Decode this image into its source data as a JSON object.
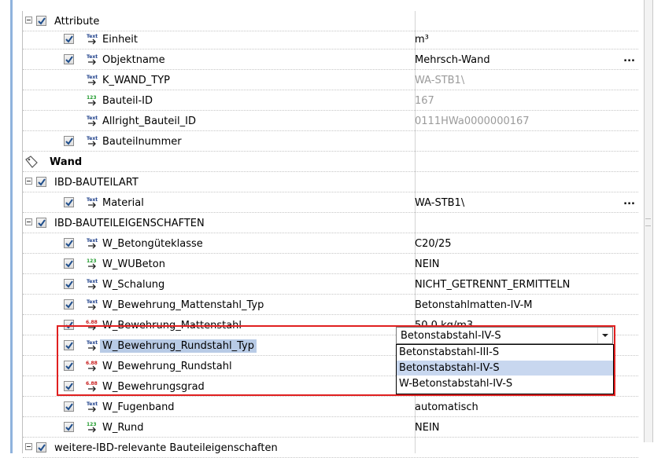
{
  "rows": [
    {
      "type": "section",
      "label": "Attribute"
    },
    {
      "type": "attr",
      "icon": "text",
      "label": "Einheit",
      "value": "m³",
      "checkbox": true
    },
    {
      "type": "attr",
      "icon": "text",
      "label": "Objektname",
      "value": "Mehrsch-Wand",
      "checkbox": true,
      "ellipsis": "..."
    },
    {
      "type": "attr",
      "icon": "text",
      "label": "K_WAND_TYP",
      "value": "WA-STB1\\",
      "checkbox": false,
      "gray": true
    },
    {
      "type": "attr",
      "icon": "int",
      "label": "Bauteil-ID",
      "value": "167",
      "checkbox": false,
      "gray": true
    },
    {
      "type": "attr",
      "icon": "text",
      "label": "Allright_Bauteil_ID",
      "value": "0111HWa0000000167",
      "checkbox": false,
      "gray": true
    },
    {
      "type": "attr",
      "icon": "text",
      "label": "Bauteilnummer",
      "value": "",
      "checkbox": true
    },
    {
      "type": "group",
      "label": "Wand"
    },
    {
      "type": "section",
      "label": "IBD-BAUTEILART"
    },
    {
      "type": "attr",
      "icon": "text",
      "label": "Material",
      "value": "WA-STB1\\",
      "checkbox": true,
      "ellipsis": "..."
    },
    {
      "type": "section",
      "label": "IBD-BAUTEILEIGENSCHAFTEN"
    },
    {
      "type": "attr",
      "icon": "text",
      "label": "W_Betongüteklasse",
      "value": "C20/25",
      "checkbox": true
    },
    {
      "type": "attr",
      "icon": "int",
      "label": "W_WUBeton",
      "value": "NEIN",
      "checkbox": true
    },
    {
      "type": "attr",
      "icon": "text",
      "label": "W_Schalung",
      "value": "NICHT_GETRENNT_ERMITTELN",
      "checkbox": true
    },
    {
      "type": "attr",
      "icon": "text",
      "label": "W_Bewehrung_Mattenstahl_Typ",
      "value": "Betonstahlmatten-IV-M",
      "checkbox": true
    },
    {
      "type": "attr",
      "icon": "float",
      "label": "W_Bewehrung_Mattenstahl",
      "value": "50.0 kg/m3",
      "checkbox": true
    },
    {
      "type": "attr",
      "icon": "text",
      "label": "W_Bewehrung_Rundstahl_Typ",
      "value": "",
      "checkbox": true,
      "selected": true
    },
    {
      "type": "attr",
      "icon": "float",
      "label": "W_Bewehrung_Rundstahl",
      "value": "",
      "checkbox": true
    },
    {
      "type": "attr",
      "icon": "float",
      "label": "W_Bewehrungsgrad",
      "value": "",
      "checkbox": true
    },
    {
      "type": "attr",
      "icon": "text",
      "label": "W_Fugenband",
      "value": "automatisch",
      "checkbox": true
    },
    {
      "type": "attr",
      "icon": "int",
      "label": "W_Rund",
      "value": "NEIN",
      "checkbox": true
    },
    {
      "type": "section",
      "label": "weitere-IBD-relevante Bauteileigenschaften"
    }
  ],
  "dropdown": {
    "value": "Betonstabstahl-IV-S",
    "options": [
      "Betonstabstahl-III-S",
      "Betonstabstahl-IV-S",
      "W-Betonstabstahl-IV-S"
    ],
    "highlighted_index": 1
  },
  "icons": {
    "text": "Text",
    "int": "123",
    "float": "6.88"
  },
  "colors": {
    "highlight_box": "#e02020",
    "selection": "#b8cbe6",
    "checkbox_check": "#1f4e8c"
  }
}
